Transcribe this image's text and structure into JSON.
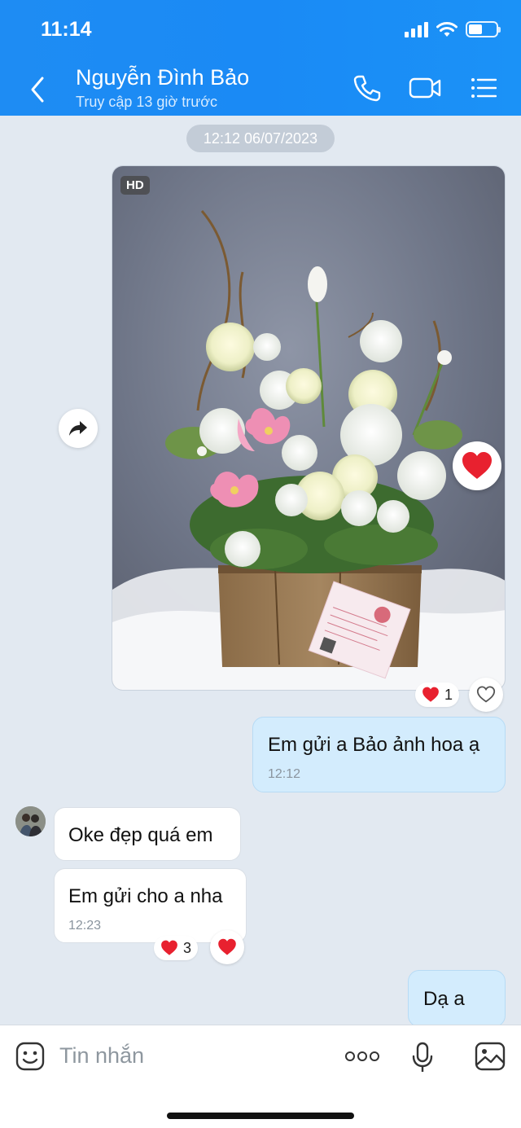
{
  "status_bar": {
    "time": "11:14"
  },
  "header": {
    "contact_name": "Nguyễn Đình Bảo",
    "contact_status": "Truy cập 13 giờ trước"
  },
  "chat": {
    "date_separator": "12:12 06/07/2023",
    "photo": {
      "badge": "HD",
      "reaction_count": "1"
    },
    "messages": [
      {
        "from": "me",
        "text": "Em gửi a Bảo ảnh hoa ạ",
        "time": "12:12"
      },
      {
        "from": "other",
        "text": "Oke đẹp quá em"
      },
      {
        "from": "other",
        "text": "Em gửi cho a nha",
        "time": "12:23",
        "reaction_count": "3"
      },
      {
        "from": "me",
        "text": "Dạ a"
      }
    ]
  },
  "input_bar": {
    "placeholder": "Tin nhắn"
  },
  "colors": {
    "header_blue": "#1a8af5",
    "my_bubble": "#d3ecfd",
    "chat_bg": "#e2e9f1",
    "heart_red": "#e8212f"
  }
}
